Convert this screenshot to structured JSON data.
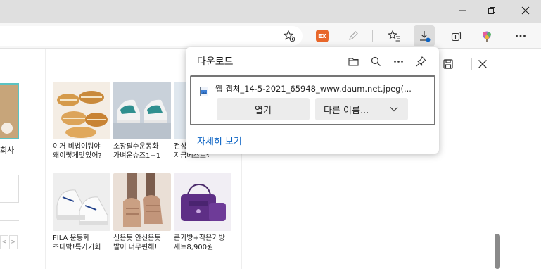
{
  "window": {
    "minimize_icon": "minimize-icon",
    "restore_icon": "restore-icon",
    "close_icon": "close-icon"
  },
  "toolbar": {
    "extension_badge": "EX",
    "icons": [
      "add-favorite-icon",
      "extension-ex-icon",
      "pen-icon",
      "favorites-icon",
      "downloads-icon",
      "collections-icon",
      "profile-icon",
      "more-icon"
    ]
  },
  "left_panel": {
    "caption": "회사",
    "nav_prev": "<",
    "nav_next": ">"
  },
  "products": [
    {
      "caption_line1": "이거 비법이뭐야",
      "caption_line2": "왜이렇게맛있어?",
      "image": "food-bread"
    },
    {
      "caption_line1": "소장필수운동화",
      "caption_line2": "가벼운슈즈1+1",
      "image": "sneakers-teal"
    },
    {
      "caption_line1": "전상",
      "caption_line2": "지금베스트셀러!",
      "image": "partial"
    },
    {
      "caption_line1": "FILA 운동화",
      "caption_line2": "초대박!특가기회",
      "image": "sneakers-white"
    },
    {
      "caption_line1": "신은듯 안신은듯",
      "caption_line2": "발이 너무편해!",
      "image": "sandals"
    },
    {
      "caption_line1": "큰가방+작은가방",
      "caption_line2": "세트8,900원",
      "image": "purple-bags"
    }
  ],
  "download_panel": {
    "title": "다운로드",
    "header_icons": [
      "open-folder-icon",
      "search-icon",
      "more-options-icon",
      "pin-icon"
    ],
    "item": {
      "filename": "웹 캡처_14-5-2021_65948_www.daum.net.jpeg(...",
      "open_label": "열기",
      "save_as_label": "다른 이름...",
      "file_icon": "image-file-icon"
    },
    "see_more": "자세히 보기"
  },
  "colors": {
    "titlebar": "#dfdfdf",
    "toolbar": "#f7f7f7",
    "link": "#0b63c4",
    "badge": "#e8672a",
    "download_active": "#dcdcdc"
  }
}
